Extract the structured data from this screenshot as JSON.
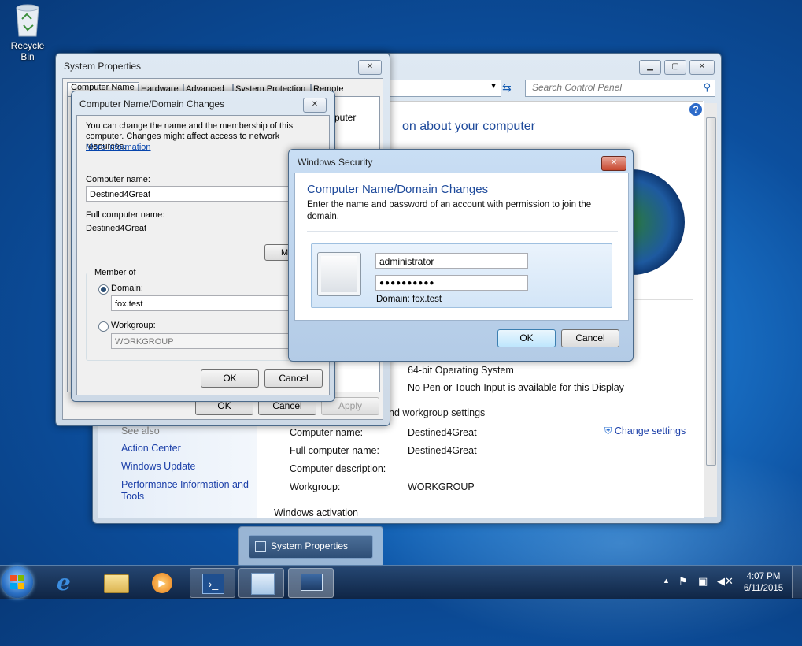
{
  "desktop": {
    "recycle_bin_label": "Recycle Bin"
  },
  "control_panel": {
    "search_placeholder": "Search Control Panel",
    "heading_partial": "on about your computer",
    "system_type": "64-bit Operating System",
    "pen_touch": "No Pen or Touch Input is available for this Display",
    "section_title": "nd workgroup settings",
    "change_settings": "Change settings",
    "see_also": "See also",
    "links": [
      "Action Center",
      "Windows Update",
      "Performance Information and Tools"
    ],
    "rows": [
      {
        "label": "Computer name:",
        "value": "Destined4Great"
      },
      {
        "label": "Full computer name:",
        "value": "Destined4Great"
      },
      {
        "label": "Computer description:",
        "value": ""
      },
      {
        "label": "Workgroup:",
        "value": "WORKGROUP"
      }
    ],
    "activation_title": "Windows activation"
  },
  "system_properties": {
    "title": "System Properties",
    "tabs": [
      "Computer Name",
      "Hardware",
      "Advanced",
      "System Protection",
      "Remote"
    ],
    "partial_text": "puter",
    "ok": "OK",
    "cancel": "Cancel",
    "apply": "Apply"
  },
  "name_changes": {
    "title": "Computer Name/Domain Changes",
    "info": "You can change the name and the membership of this computer. Changes might affect access to network resources.",
    "more_info": "More information",
    "computer_name_label": "Computer name:",
    "computer_name_value": "Destined4Great",
    "full_name_label": "Full computer name:",
    "full_name_value": "Destined4Great",
    "more_button": "Mo",
    "member_of": "Member of",
    "domain_label": "Domain:",
    "domain_value": "fox.test",
    "workgroup_label": "Workgroup:",
    "workgroup_value": "WORKGROUP",
    "ok": "OK",
    "cancel": "Cancel"
  },
  "security": {
    "title": "Windows Security",
    "heading": "Computer Name/Domain Changes",
    "description": "Enter the name and password of an account with permission to join the domain.",
    "username": "administrator",
    "password": "●●●●●●●●●●",
    "domain": "Domain: fox.test",
    "ok": "OK",
    "cancel": "Cancel"
  },
  "taskbar": {
    "thumbnail_label": "System Properties",
    "time": "4:07 PM",
    "date": "6/11/2015"
  }
}
